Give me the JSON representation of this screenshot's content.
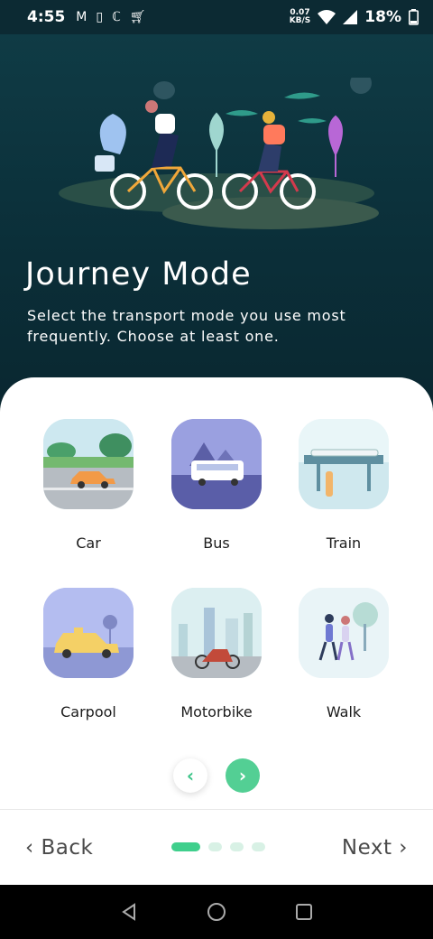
{
  "status_bar": {
    "time": "4:55",
    "speed_value": "0.07",
    "speed_unit": "KB/S",
    "battery": "18%"
  },
  "hero": {
    "title": "Journey Mode",
    "description": "Select the transport mode you use most frequently. Choose at least one."
  },
  "modes": [
    {
      "label": "Car"
    },
    {
      "label": "Bus"
    },
    {
      "label": "Train"
    },
    {
      "label": "Carpool"
    },
    {
      "label": "Motorbike"
    },
    {
      "label": "Walk"
    }
  ],
  "footer": {
    "back_label": "Back",
    "next_label": "Next",
    "page_count": 4,
    "current_page": 1
  },
  "colors": {
    "accent": "#3fcf8c",
    "hero_bg": "#0f3b45"
  }
}
